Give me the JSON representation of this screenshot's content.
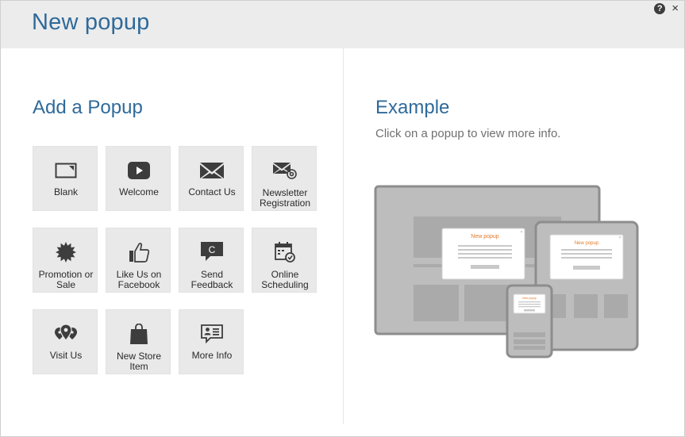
{
  "dialog": {
    "title": "New popup",
    "help_icon": "help-icon",
    "help_glyph": "?",
    "close_icon": "close-icon",
    "close_glyph": "×"
  },
  "left": {
    "title": "Add a Popup",
    "tiles": [
      {
        "label": "Blank",
        "icon": "blank-window-icon"
      },
      {
        "label": "Welcome",
        "icon": "play-icon"
      },
      {
        "label": "Contact Us",
        "icon": "envelope-icon"
      },
      {
        "label": "Newsletter\nRegistration",
        "icon": "envelope-at-icon"
      },
      {
        "label": "Promotion or\nSale",
        "icon": "starburst-icon"
      },
      {
        "label": "Like Us on\nFacebook",
        "icon": "thumbs-up-icon"
      },
      {
        "label": "Send\nFeedback",
        "icon": "speech-bubble-icon"
      },
      {
        "label": "Online\nScheduling",
        "icon": "calendar-check-icon"
      },
      {
        "label": "Visit Us",
        "icon": "map-pins-icon"
      },
      {
        "label": "New Store\nItem",
        "icon": "shopping-bag-icon"
      },
      {
        "label": "More Info",
        "icon": "info-card-icon"
      }
    ]
  },
  "right": {
    "title": "Example",
    "subtitle": "Click on a popup to view more info.",
    "illustration": {
      "popup_title": "New popup",
      "accent_color": "#e07a2a"
    }
  },
  "colors": {
    "title_blue": "#2f6a9a",
    "tile_bg": "#e9e9e9",
    "header_bg": "#ececec",
    "icon_dark": "#3d3d3d"
  }
}
